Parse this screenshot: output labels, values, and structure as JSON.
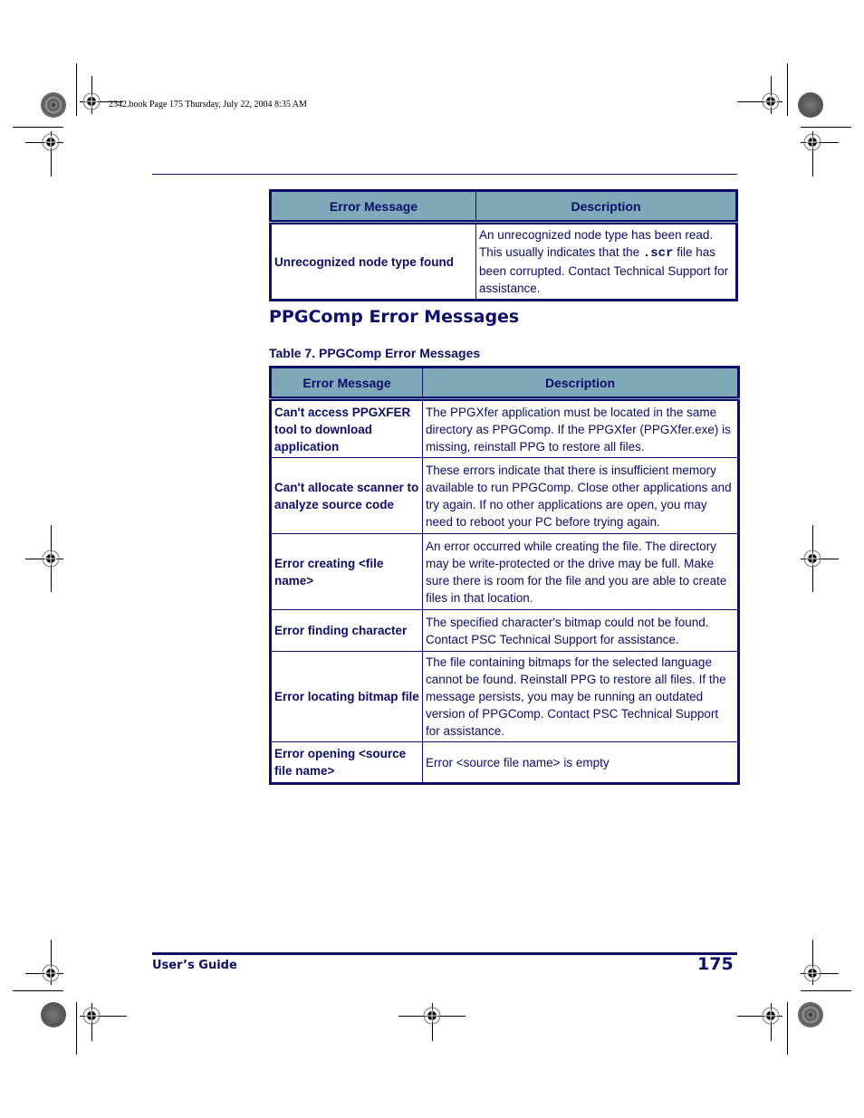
{
  "slug": "2342.book  Page 175  Thursday, July 22, 2004  8:35 AM",
  "table_continued": {
    "headers": [
      "Error Message",
      "Description"
    ],
    "rows": [
      {
        "message": "Unrecognized node type found",
        "description_pre": "An unrecognized node type has been read. This usually indicates that the ",
        "description_code": ".scr",
        "description_post": " file has been corrupted. Contact Technical Support for assistance."
      }
    ]
  },
  "section": {
    "title": "PPGComp Error Messages",
    "table_caption": "Table 7. PPGComp Error Messages"
  },
  "table7": {
    "headers": [
      "Error Message",
      "Description"
    ],
    "rows": [
      {
        "message": "Can't access PPGXFER tool to download application",
        "description": "The PPGXfer application must be located in the same directory as PPGComp. If the PPGXfer (PPGXfer.exe) is missing, reinstall PPG to restore all files."
      },
      {
        "message": "Can't allocate scanner to analyze source code",
        "description": "These errors indicate that there is insufficient memory available to run PPGComp. Close other applications and try again. If no other applications are open, you may need to reboot your PC before trying again."
      },
      {
        "message": "Error creating <file name>",
        "description": "An error occurred while creating the file. The directory may be write-protected or the drive may be full. Make sure there is room for the file and you are able to create files in that location."
      },
      {
        "message": "Error finding character",
        "description": "The specified character's bitmap could not be found. Contact PSC Technical Support for assistance."
      },
      {
        "message": "Error locating bitmap file",
        "description": "The file containing bitmaps for the selected language cannot be found. Reinstall PPG to restore all files. If the message persists, you may be running an outdated version of PPGComp. Contact PSC Technical Support for assistance."
      },
      {
        "message": "Error opening <source file name>",
        "description": "Error <source file name> is empty"
      }
    ]
  },
  "footer": {
    "guide_title": "User’s Guide",
    "page_number": "175"
  },
  "colors": {
    "brand_navy": "#0d0d6b",
    "header_fill": "#7fa8b8"
  }
}
